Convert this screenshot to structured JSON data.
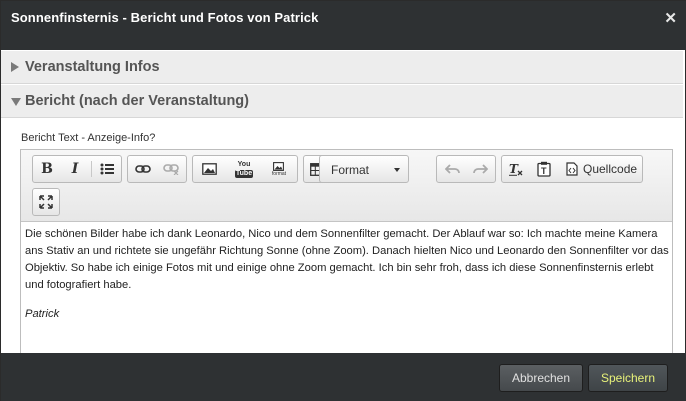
{
  "dialog": {
    "title": "Sonnenfinsternis - Bericht und Fotos von Patrick",
    "close_glyph": "✕"
  },
  "sections": [
    {
      "label": "Veranstaltung Infos",
      "expanded": false
    },
    {
      "label": "Bericht (nach der Veranstaltung)",
      "expanded": true
    }
  ],
  "form": {
    "field_label": "Bericht Text - Anzeige-Info?"
  },
  "toolbar": {
    "bold": "B",
    "italic": "I",
    "format_label": "Format",
    "source_label": "Quellcode",
    "youtube_top": "You",
    "youtube_bottom": "Tube",
    "image_format_label": "format",
    "icons": [
      "bold-icon",
      "italic-icon",
      "bulleted-list-icon",
      "link-icon",
      "unlink-icon",
      "image-icon",
      "youtube-icon",
      "image-format-icon",
      "table-icon",
      "undo-icon",
      "redo-icon",
      "remove-format-icon",
      "paste-text-icon",
      "source-code-icon",
      "maximize-icon"
    ]
  },
  "content": {
    "paragraph": "Die schönen Bilder habe ich dank Leonardo, Nico und dem Sonnenfilter gemacht. Der Ablauf war so: Ich machte meine Kamera ans Stativ an und richtete sie ungefähr Richtung Sonne (ohne Zoom). Danach hielten Nico und Leonardo den Sonnenfilter vor das Objektiv. So habe ich einige Fotos mit und einige ohne Zoom gemacht. Ich bin sehr froh, dass ich diese Sonnenfinsternis erlebt und fotografiert habe.",
    "signature": "Patrick"
  },
  "footer": {
    "cancel_label": "Abbrechen",
    "save_label": "Speichern"
  },
  "colors": {
    "titlebar": "#2e3133",
    "save_text": "#e8f27a"
  }
}
